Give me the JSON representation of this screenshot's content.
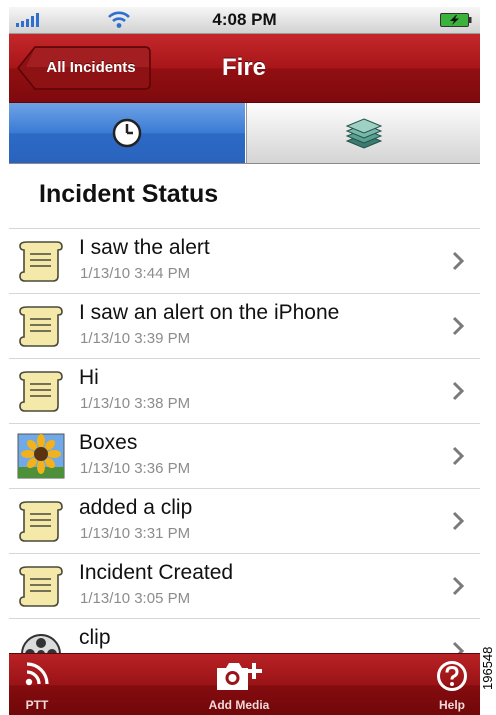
{
  "status_bar": {
    "time": "4:08 PM",
    "signal_icon": "signal-bars-icon",
    "wifi_icon": "wifi-icon",
    "battery_icon": "battery-charging-icon"
  },
  "nav_bar": {
    "back_label": "All Incidents",
    "title": "Fire"
  },
  "tabs": [
    {
      "icon": "clock-icon",
      "selected": true
    },
    {
      "icon": "layers-icon",
      "selected": false
    }
  ],
  "section": {
    "title": "Incident Status"
  },
  "items": [
    {
      "title": "I saw the alert",
      "time": "1/13/10 3:44 PM",
      "icon": "scroll-icon"
    },
    {
      "title": "I saw an alert on the iPhone",
      "time": "1/13/10 3:39 PM",
      "icon": "scroll-icon"
    },
    {
      "title": "Hi",
      "time": "1/13/10 3:38 PM",
      "icon": "scroll-icon"
    },
    {
      "title": "Boxes",
      "time": "1/13/10 3:36 PM",
      "icon": "sunflower-photo-icon"
    },
    {
      "title": "added a clip",
      "time": "1/13/10 3:31 PM",
      "icon": "scroll-icon"
    },
    {
      "title": "Incident Created",
      "time": "1/13/10 3:05 PM",
      "icon": "scroll-icon"
    },
    {
      "title": "clip",
      "time": "",
      "icon": "film-reel-icon"
    }
  ],
  "toolbar": {
    "ptt_label": "PTT",
    "add_media_label": "Add Media",
    "help_label": "Help"
  },
  "figure_id": "196548",
  "colors": {
    "nav_red": "#a81619",
    "tab_blue": "#3a7bd5",
    "secondary_text": "#8c8c8c"
  }
}
